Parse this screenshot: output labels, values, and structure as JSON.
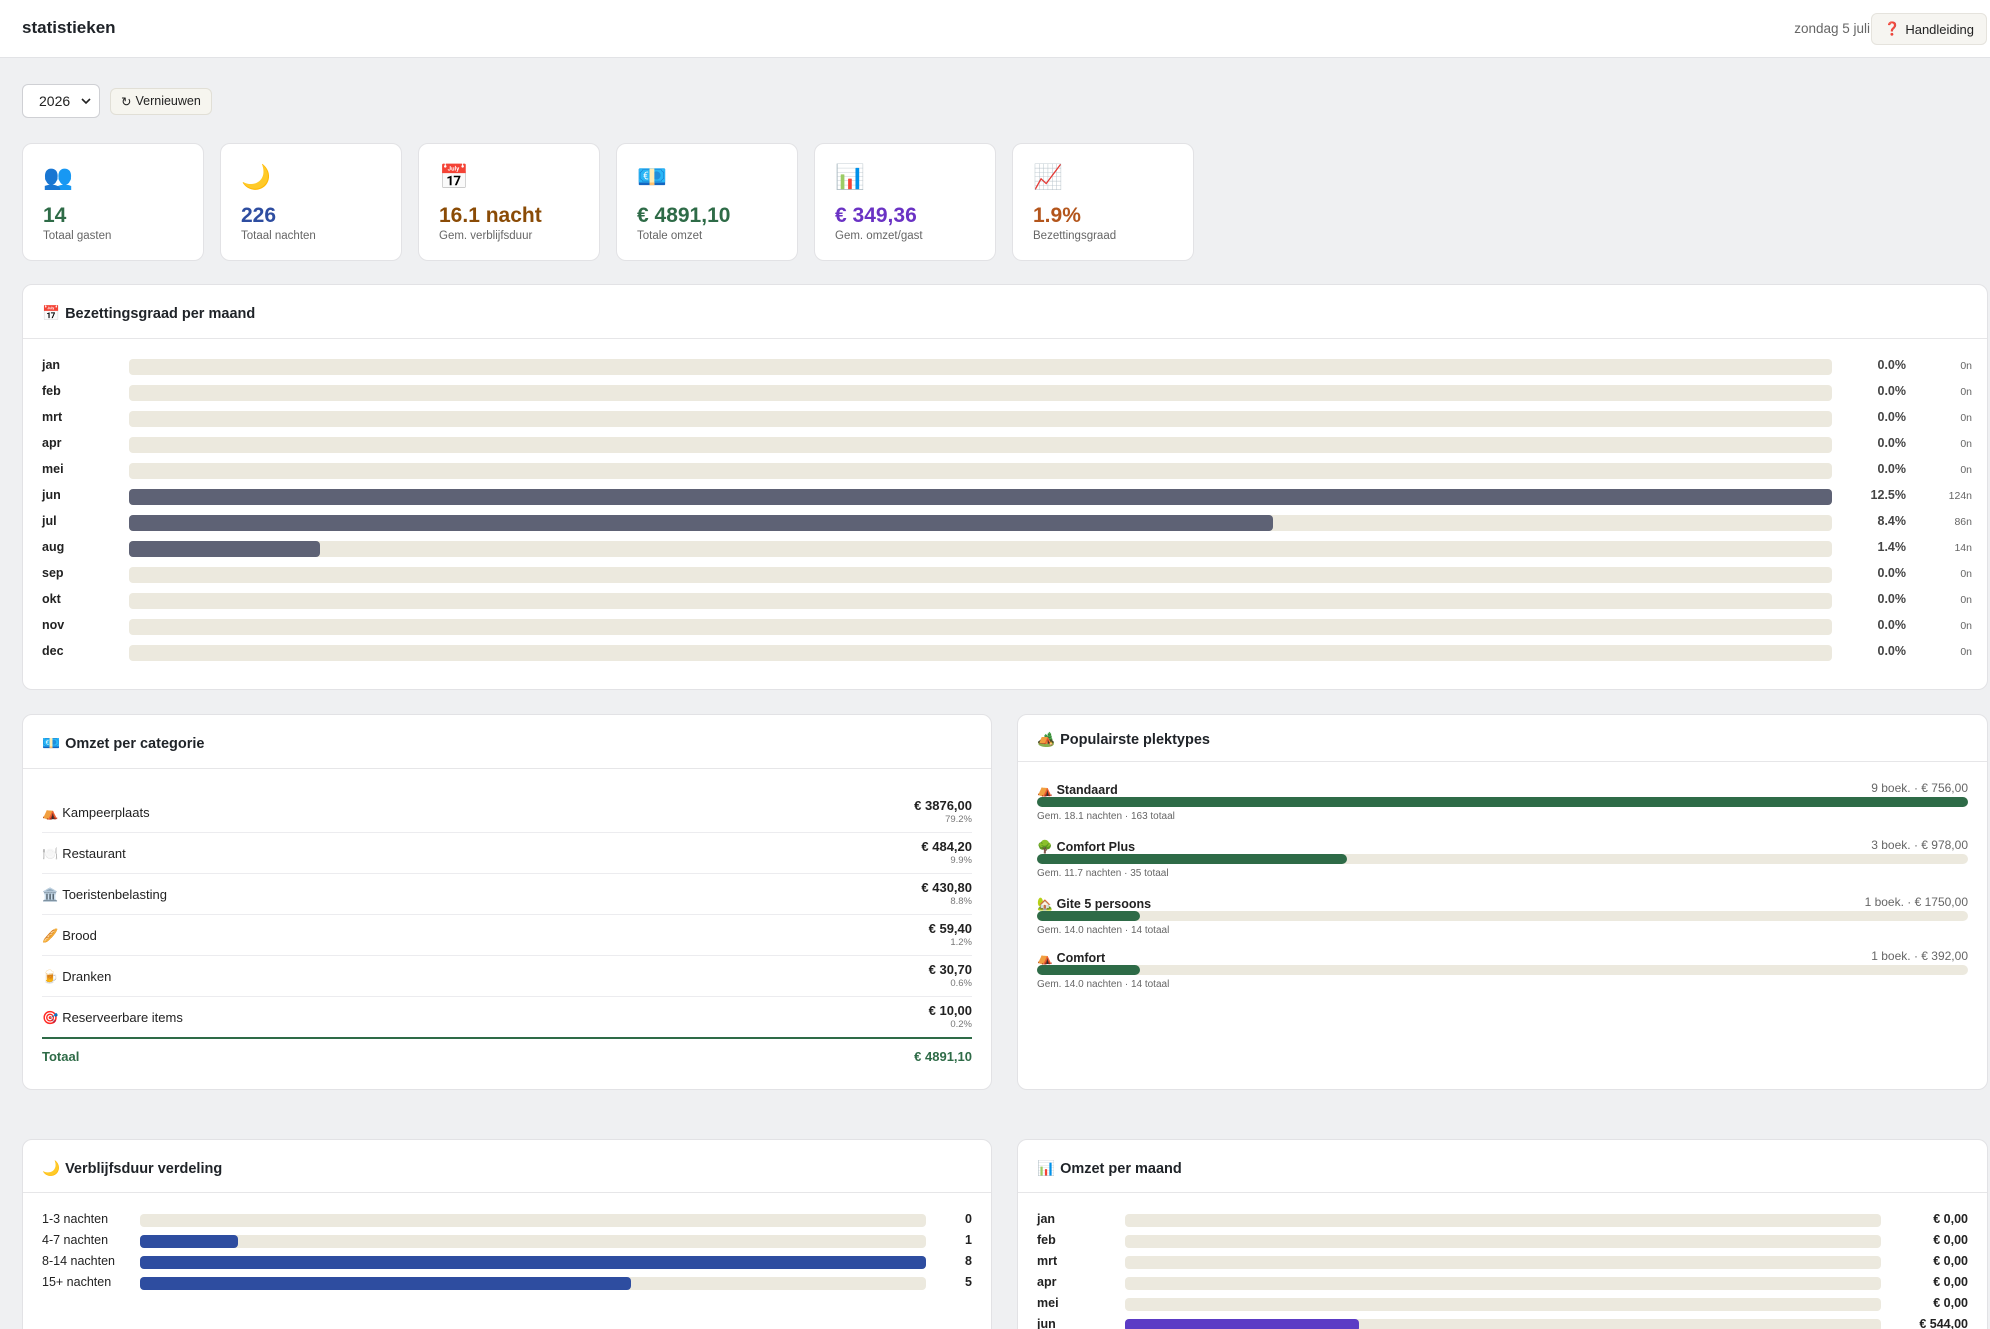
{
  "header": {
    "title": "statistieken",
    "date": "zondag 5 juli",
    "help_icon": "❓",
    "help_label": "Handleiding"
  },
  "controls": {
    "year": "2026",
    "refresh_label": "Vernieuwen",
    "refresh_icon": "↻"
  },
  "stats": [
    {
      "icon": "👥",
      "value": "14",
      "label": "Totaal gasten",
      "color": "#2e6b47"
    },
    {
      "icon": "🌙",
      "value": "226",
      "label": "Totaal nachten",
      "color": "#2e4da0"
    },
    {
      "icon": "📅",
      "value": "16.1 nacht",
      "label": "Gem. verblijfsduur",
      "color": "#8a4b06"
    },
    {
      "icon": "💶",
      "value": "€ 4891,10",
      "label": "Totale omzet",
      "color": "#2e6b47"
    },
    {
      "icon": "📊",
      "value": "€ 349,36",
      "label": "Gem. omzet/gast",
      "color": "#6a32c4"
    },
    {
      "icon": "📈",
      "value": "1.9%",
      "label": "Bezettingsgraad",
      "color": "#b3551c"
    }
  ],
  "occupancy": {
    "icon": "📅",
    "title": "Bezettingsgraad per maand",
    "months": [
      {
        "month": "jan",
        "pct": "0.0%",
        "nights": "0n",
        "fill": 0
      },
      {
        "month": "feb",
        "pct": "0.0%",
        "nights": "0n",
        "fill": 0
      },
      {
        "month": "mrt",
        "pct": "0.0%",
        "nights": "0n",
        "fill": 0
      },
      {
        "month": "apr",
        "pct": "0.0%",
        "nights": "0n",
        "fill": 0
      },
      {
        "month": "mei",
        "pct": "0.0%",
        "nights": "0n",
        "fill": 0
      },
      {
        "month": "jun",
        "pct": "12.5%",
        "nights": "124n",
        "fill": 1.0
      },
      {
        "month": "jul",
        "pct": "8.4%",
        "nights": "86n",
        "fill": 0.672
      },
      {
        "month": "aug",
        "pct": "1.4%",
        "nights": "14n",
        "fill": 0.112
      },
      {
        "month": "sep",
        "pct": "0.0%",
        "nights": "0n",
        "fill": 0
      },
      {
        "month": "okt",
        "pct": "0.0%",
        "nights": "0n",
        "fill": 0
      },
      {
        "month": "nov",
        "pct": "0.0%",
        "nights": "0n",
        "fill": 0
      },
      {
        "month": "dec",
        "pct": "0.0%",
        "nights": "0n",
        "fill": 0
      }
    ]
  },
  "revenue_category": {
    "icon": "💶",
    "title": "Omzet per categorie",
    "items": [
      {
        "icon": "⛺",
        "name": "Kampeerplaats",
        "amount": "€ 3876,00",
        "share": "79.2%"
      },
      {
        "icon": "🍽️",
        "name": "Restaurant",
        "amount": "€ 484,20",
        "share": "9.9%"
      },
      {
        "icon": "🏛️",
        "name": "Toeristenbelasting",
        "amount": "€ 430,80",
        "share": "8.8%"
      },
      {
        "icon": "🥖",
        "name": "Brood",
        "amount": "€ 59,40",
        "share": "1.2%"
      },
      {
        "icon": "🍺",
        "name": "Dranken",
        "amount": "€ 30,70",
        "share": "0.6%"
      },
      {
        "icon": "🎯",
        "name": "Reserveerbare items",
        "amount": "€ 10,00",
        "share": "0.2%"
      }
    ],
    "total_label": "Totaal",
    "total_amount": "€ 4891,10"
  },
  "pitch_types": {
    "icon": "🏕️",
    "title": "Populairste plektypes",
    "items": [
      {
        "icon": "⛺",
        "name": "Standaard",
        "meta": "9 boek. · € 756,00",
        "sub": "Gem. 18.1 nachten · 163 totaal",
        "fill": 1.0
      },
      {
        "icon": "🌳",
        "name": "Comfort Plus",
        "meta": "3 boek. · € 978,00",
        "sub": "Gem. 11.7 nachten · 35 totaal",
        "fill": 0.333
      },
      {
        "icon": "🏡",
        "name": "Gite 5 persoons",
        "meta": "1 boek. · € 1750,00",
        "sub": "Gem. 14.0 nachten · 14 totaal",
        "fill": 0.111
      },
      {
        "icon": "⛺",
        "name": "Comfort",
        "meta": "1 boek. · € 392,00",
        "sub": "Gem. 14.0 nachten · 14 totaal",
        "fill": 0.111
      }
    ]
  },
  "stay_duration": {
    "icon": "🌙",
    "title": "Verblijfsduur verdeling",
    "items": [
      {
        "label": "1-3 nachten",
        "count": "0",
        "fill": 0
      },
      {
        "label": "4-7 nachten",
        "count": "1",
        "fill": 0.125
      },
      {
        "label": "8-14 nachten",
        "count": "8",
        "fill": 1.0
      },
      {
        "label": "15+ nachten",
        "count": "5",
        "fill": 0.625
      }
    ]
  },
  "revenue_month": {
    "icon": "📊",
    "title": "Omzet per maand",
    "months": [
      {
        "month": "jan",
        "amount": "€ 0,00",
        "fill": 0
      },
      {
        "month": "feb",
        "amount": "€ 0,00",
        "fill": 0
      },
      {
        "month": "mrt",
        "amount": "€ 0,00",
        "fill": 0
      },
      {
        "month": "apr",
        "amount": "€ 0,00",
        "fill": 0
      },
      {
        "month": "mei",
        "amount": "€ 0,00",
        "fill": 0
      },
      {
        "month": "jun",
        "amount": "€ 544,00",
        "fill": 0.31
      }
    ]
  }
}
